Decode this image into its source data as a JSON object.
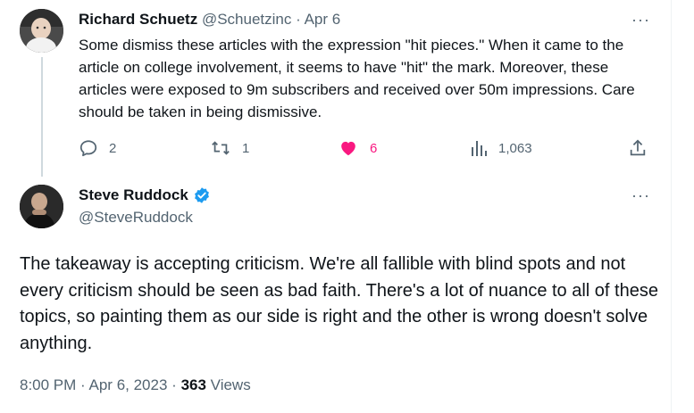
{
  "reply_tweet": {
    "author_name": "Richard Schuetz",
    "author_handle": "@Schuetzinc",
    "separator": "·",
    "date": "Apr 6",
    "text": "Some dismiss these articles with the expression \"hit pieces.\"  When it came to the article on college involvement, it seems to have \"hit\" the mark. Moreover, these articles were exposed to 9m subscribers and received over 50m impressions. Care should be taken in being dismissive.",
    "replies": "2",
    "reposts": "1",
    "likes": "6",
    "views": "1,063",
    "more_label": "···"
  },
  "main_tweet": {
    "author_name": "Steve Ruddock",
    "author_handle": "@SteveRuddock",
    "verified": true,
    "text": "The takeaway is accepting criticism. We're all fallible with blind spots and not every criticism should be seen as bad faith. There's a lot of nuance to all of these topics, so painting them as our side is right and the other is wrong doesn't solve anything.",
    "time": "8:00 PM",
    "dot": "·",
    "date": "Apr 6, 2023",
    "view_count": "363",
    "views_label": "Views",
    "more_label": "···"
  },
  "colors": {
    "text": "#0f1419",
    "muted": "#536471",
    "like_pink": "#f91880",
    "verified_blue": "#1d9bf0",
    "thread_line": "#cfd9de"
  },
  "icons": [
    "reply-icon",
    "retweet-icon",
    "heart-icon",
    "views-icon",
    "share-icon",
    "verified-badge-icon",
    "more-icon"
  ]
}
